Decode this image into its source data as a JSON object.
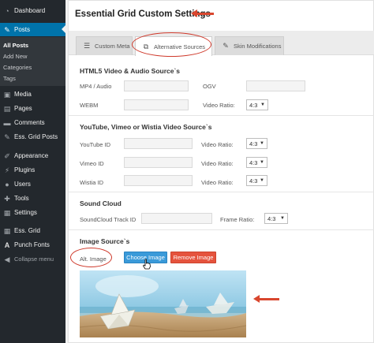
{
  "sidebar": {
    "items": [
      {
        "label": "Dashboard",
        "icon": "dashboard-icon"
      },
      {
        "label": "Posts",
        "icon": "pin-icon"
      },
      {
        "label": "Media",
        "icon": "media-icon"
      },
      {
        "label": "Pages",
        "icon": "pages-icon"
      },
      {
        "label": "Comments",
        "icon": "comments-icon"
      },
      {
        "label": "Ess. Grid Posts",
        "icon": "pin-icon"
      },
      {
        "label": "Appearance",
        "icon": "appearance-icon"
      },
      {
        "label": "Plugins",
        "icon": "plugins-icon"
      },
      {
        "label": "Users",
        "icon": "users-icon"
      },
      {
        "label": "Tools",
        "icon": "tools-icon"
      },
      {
        "label": "Settings",
        "icon": "settings-icon"
      },
      {
        "label": "Ess. Grid",
        "icon": "grid-icon"
      },
      {
        "label": "Punch Fonts",
        "icon": "fonts-icon"
      },
      {
        "label": "Collapse menu",
        "icon": "collapse-icon"
      }
    ],
    "submenu": [
      "All Posts",
      "Add New",
      "Categories",
      "Tags"
    ]
  },
  "main": {
    "title": "Essential Grid Custom Settings",
    "tabs": [
      {
        "label": "Custom Meta",
        "icon": "list-icon"
      },
      {
        "label": "Alternative Sources",
        "icon": "media-icon"
      },
      {
        "label": "Skin Modifications",
        "icon": "pin-icon"
      }
    ],
    "html5": {
      "title": "HTML5 Video & Audio Source`s",
      "mp4_label": "MP4 / Audio",
      "ogv_label": "OGV",
      "webm_label": "WEBM",
      "ratio_label": "Video Ratio:",
      "ratio_value": "4:3"
    },
    "youtube": {
      "title": "YouTube, Vimeo or Wistia Video Source`s",
      "youtube_label": "YouTube ID",
      "vimeo_label": "Vimeo ID",
      "wistia_label": "Wistia ID",
      "ratio_label": "Video Ratio:",
      "ratio_value": "4:3"
    },
    "soundcloud": {
      "title": "Sound Cloud",
      "track_label": "SoundCloud Track ID",
      "ratio_label": "Frame Ratio:",
      "ratio_value": "4:3"
    },
    "image": {
      "title": "Image Source`s",
      "alt_label": "Alt. Image",
      "choose_button": "Choose Image",
      "remove_button": "Remove Image"
    }
  },
  "colors": {
    "sidebar_bg": "#23282d",
    "active_blue": "#0073aa",
    "button_blue": "#3a9ad9",
    "button_red": "#e5533d",
    "annotation_red": "#d9462e"
  }
}
